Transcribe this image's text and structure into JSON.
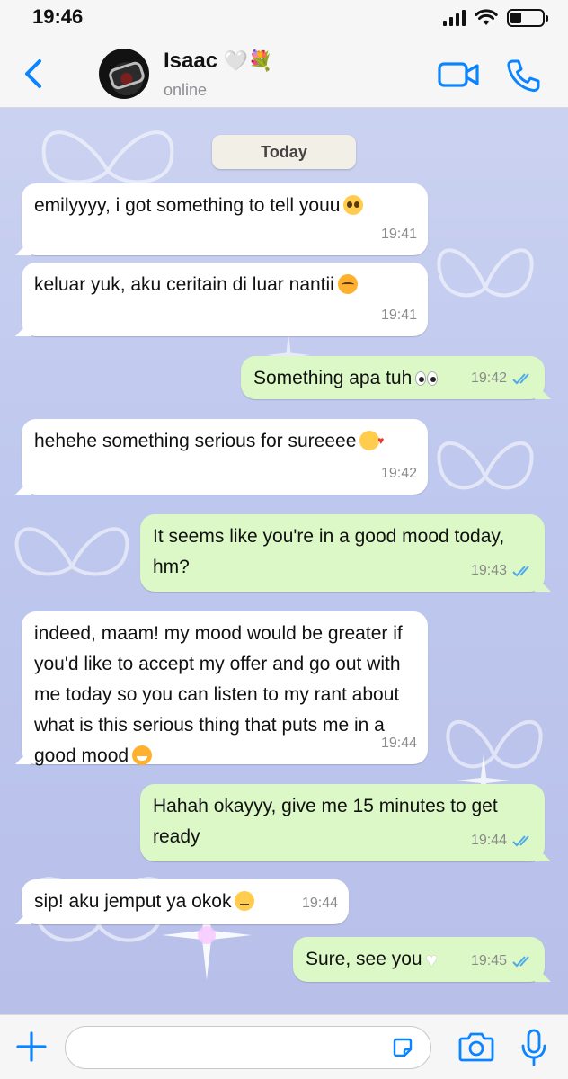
{
  "status_bar": {
    "time": "19:46"
  },
  "header": {
    "contact_name": "Isaac",
    "contact_emojis": "🤍💐",
    "contact_status": "online"
  },
  "chat": {
    "date_label": "Today",
    "messages": [
      {
        "dir": "in",
        "text": "emilyyyy, i got something to tell youu",
        "emoji": "pleading-face",
        "time": "19:41"
      },
      {
        "dir": "in",
        "text": "keluar yuk, aku ceritain di luar nantii",
        "emoji": "kissing-cat-face",
        "time": "19:41"
      },
      {
        "dir": "out",
        "text": "Something apa tuh",
        "emoji": "eyes",
        "time": "19:42",
        "read": true
      },
      {
        "dir": "in",
        "text": "hehehe something serious for sureeee",
        "emoji": "smiling-face-with-hearts",
        "time": "19:42"
      },
      {
        "dir": "out",
        "text": "It seems like you're in a good mood today, hm?",
        "time": "19:43",
        "read": true
      },
      {
        "dir": "in",
        "text": "indeed, maam! my mood would be greater if you'd like to accept my offer and go out with me today so you can listen to my rant about what is this serious thing that puts me in a good mood",
        "emoji": "grinning-cat-face",
        "time": "19:44"
      },
      {
        "dir": "out",
        "text": "Hahah okayyy, give me 15 minutes to get ready",
        "time": "19:44",
        "read": true
      },
      {
        "dir": "in",
        "text": "sip! aku jemput ya okok",
        "emoji": "saluting-face",
        "time": "19:44"
      },
      {
        "dir": "out",
        "text": "Sure, see you",
        "emoji": "white-heart",
        "time": "19:45",
        "read": true
      }
    ]
  },
  "input_bar": {
    "placeholder": ""
  },
  "colors": {
    "accent": "#0a84ff",
    "incoming_bubble": "#ffffff",
    "outgoing_bubble": "#dbf8c6",
    "read_ticks": "#4fa9e8",
    "chat_background": "#c3cbef"
  }
}
